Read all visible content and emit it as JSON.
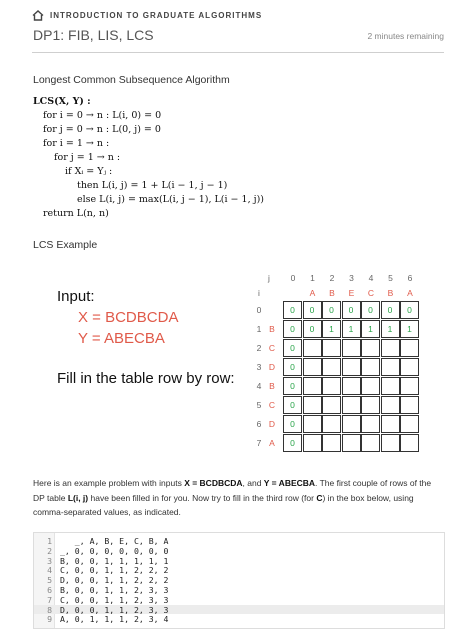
{
  "header": {
    "course": "INTRODUCTION TO GRADUATE ALGORITHMS",
    "lesson_title": "DP1: FIB, LIS, LCS",
    "time_remaining": "2 minutes remaining",
    "progress": 0.0
  },
  "algorithm": {
    "title": "Longest Common Subsequence Algorithm",
    "lines": [
      "LCS(X, Y) :",
      "for i = 0 → n : L(i, 0) = 0",
      "for j = 0 → n : L(0, j) = 0",
      "for i = 1 → n :",
      "for j = 1 → n :",
      "if Xᵢ = Yⱼ :",
      "then L(i, j) = 1 + L(i − 1, j − 1)",
      "else L(i, j) = max(L(i, j − 1), L(i − 1, j))",
      "return L(n, n)"
    ]
  },
  "example": {
    "title": "LCS Example",
    "input_label": "Input:",
    "x_line": "X = BCDBCDA",
    "y_line": "Y = ABECBA",
    "fill_label": "Fill in the table row by row:"
  },
  "table": {
    "j_label": "j",
    "i_label": "i",
    "col_indices": [
      "0",
      "1",
      "2",
      "3",
      "4",
      "5",
      "6"
    ],
    "col_letters": [
      "A",
      "B",
      "E",
      "C",
      "B",
      "A"
    ],
    "row_indices": [
      "0",
      "1",
      "2",
      "3",
      "4",
      "5",
      "6",
      "7"
    ],
    "row_letters": [
      "",
      "B",
      "C",
      "D",
      "B",
      "C",
      "D",
      "A"
    ],
    "rows": [
      [
        "0",
        "0",
        "0",
        "0",
        "0",
        "0",
        "0"
      ],
      [
        "0",
        "0",
        "1",
        "1",
        "1",
        "1",
        "1"
      ],
      [
        "0",
        "",
        "",
        "",
        "",
        "",
        ""
      ],
      [
        "0",
        "",
        "",
        "",
        "",
        "",
        ""
      ],
      [
        "0",
        "",
        "",
        "",
        "",
        "",
        ""
      ],
      [
        "0",
        "",
        "",
        "",
        "",
        "",
        ""
      ],
      [
        "0",
        "",
        "",
        "",
        "",
        "",
        ""
      ],
      [
        "0",
        "",
        "",
        "",
        "",
        "",
        ""
      ]
    ]
  },
  "instructions": {
    "p1": "Here is an example problem with inputs ",
    "x_bold": "X = BCDBCDA",
    "p2": ", and ",
    "y_bold": "Y = ABECBA",
    "p3": ". The first couple of rows of the DP table ",
    "l_bold": "L(i, j)",
    "p4": " have been filled in for you. Now try to fill in the third row (for ",
    "c_bold": "C",
    "p5": ") in the box below, using comma-separated values, as indicated."
  },
  "editor": {
    "lines": [
      {
        "num": "1",
        "text": "   _, A, B, E, C, B, A"
      },
      {
        "num": "2",
        "text": "_, 0, 0, 0, 0, 0, 0, 0"
      },
      {
        "num": "3",
        "text": "B, 0, 0, 1, 1, 1, 1, 1"
      },
      {
        "num": "4",
        "text": "C, 0, 0, 1, 1, 2, 2, 2"
      },
      {
        "num": "5",
        "text": "D, 0, 0, 1, 1, 2, 2, 2"
      },
      {
        "num": "6",
        "text": "B, 0, 0, 1, 1, 2, 3, 3"
      },
      {
        "num": "7",
        "text": "C, 0, 0, 1, 1, 2, 3, 3"
      },
      {
        "num": "8",
        "text": "D, 0, 0, 1, 1, 2, 3, 3"
      },
      {
        "num": "9",
        "text": "A, 0, 1, 1, 1, 2, 3, 4"
      }
    ],
    "active_line": "8"
  }
}
